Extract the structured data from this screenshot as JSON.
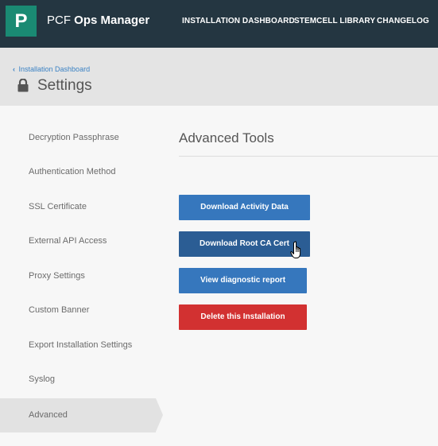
{
  "app": {
    "logo_letter": "P",
    "title_prefix": "PCF",
    "title_strong": "Ops Manager"
  },
  "nav": {
    "items": [
      {
        "label": "INSTALLATION DASHBOARD"
      },
      {
        "label": "STEMCELL LIBRARY"
      },
      {
        "label": "CHANGELOG"
      }
    ]
  },
  "header": {
    "breadcrumb": "Installation Dashboard",
    "breadcrumb_icon": "chevron-left-icon",
    "title_icon": "lock-icon",
    "title": "Settings"
  },
  "sidebar": {
    "items": [
      {
        "label": "Decryption Passphrase"
      },
      {
        "label": "Authentication Method"
      },
      {
        "label": "SSL Certificate"
      },
      {
        "label": "External API Access"
      },
      {
        "label": "Proxy Settings"
      },
      {
        "label": "Custom Banner"
      },
      {
        "label": "Export Installation Settings"
      },
      {
        "label": "Syslog"
      },
      {
        "label": "Advanced",
        "active": true
      }
    ]
  },
  "main": {
    "section_title": "Advanced Tools",
    "buttons": [
      {
        "label": "Download Activity Data",
        "color": "#3677bd"
      },
      {
        "label": "Download Root CA Cert",
        "color": "#2b5d94",
        "hovered": true
      },
      {
        "label": "View diagnostic report",
        "color": "#3677bd"
      },
      {
        "label": "Delete this Installation",
        "color": "#d23131"
      }
    ]
  },
  "cursor": {
    "icon": "hand-pointer-icon"
  },
  "colors": {
    "topbar": "#243641",
    "logo_bg": "#1a8a73",
    "link": "#3b82c4",
    "primary": "#3677bd",
    "danger": "#d23131"
  }
}
